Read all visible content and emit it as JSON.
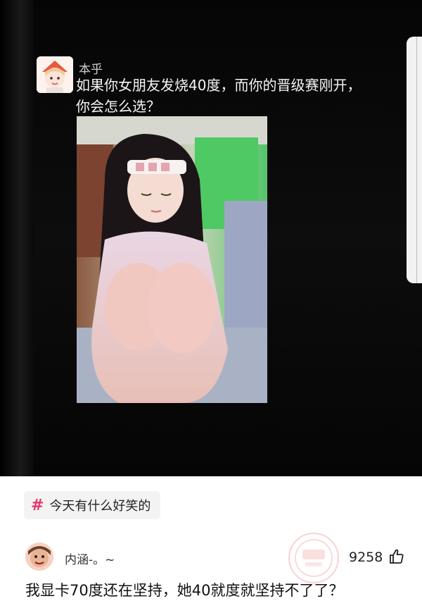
{
  "post": {
    "username": "本乎",
    "message_line1": "如果你女朋友发烧40度，而你的晋级赛刚开，",
    "message_line2": "你会怎么选？",
    "avatar_icon": "anime-avatar-icon",
    "photo": "girl-sitting-photo"
  },
  "topic": {
    "hash": "#",
    "label": "今天有什么好笑的"
  },
  "comment": {
    "user": "内涵-。~",
    "likes": "9258",
    "like_icon": "thumbs-up-icon",
    "text": "我显卡70度还在坚持，她40就度就坚持不了了？",
    "watermark_icon": "watermark-stamp-icon"
  },
  "colors": {
    "accent": "#e43a6b",
    "dark_bg": "#0a0a0a",
    "light_bg": "#ffffff"
  }
}
